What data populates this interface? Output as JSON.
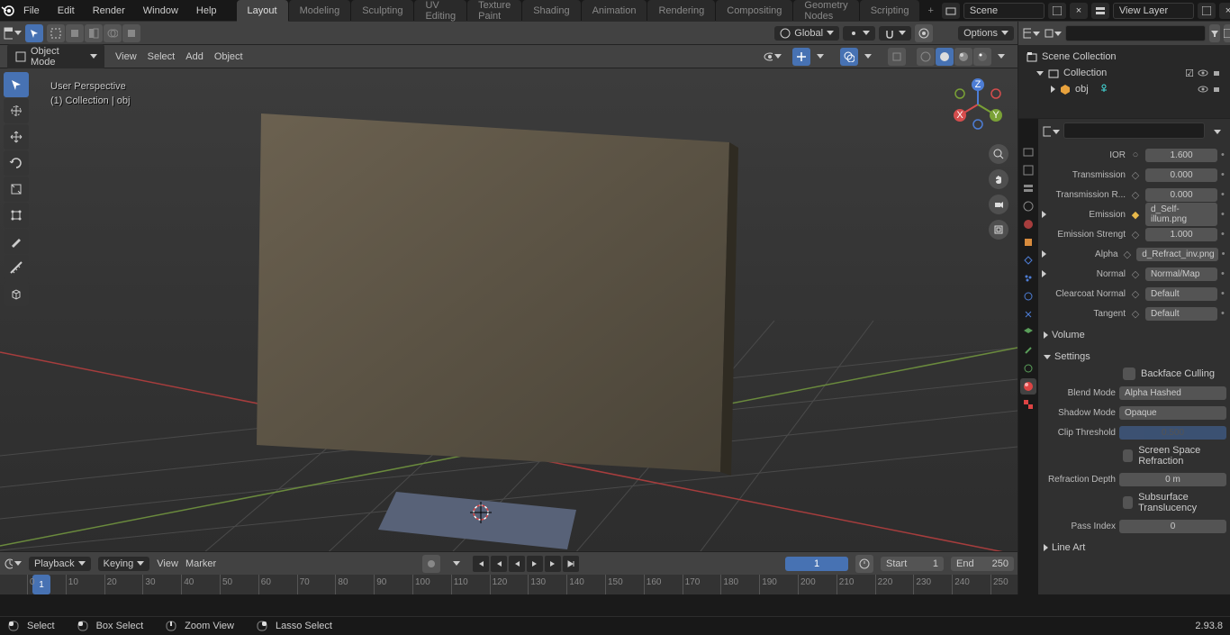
{
  "top_menu": [
    "File",
    "Edit",
    "Render",
    "Window",
    "Help"
  ],
  "workspaces": [
    "Layout",
    "Modeling",
    "Sculpting",
    "UV Editing",
    "Texture Paint",
    "Shading",
    "Animation",
    "Rendering",
    "Compositing",
    "Geometry Nodes",
    "Scripting"
  ],
  "active_workspace": 0,
  "scene_name": "Scene",
  "view_layer": "View Layer",
  "viewport": {
    "mode": "Object Mode",
    "orientation": "Global",
    "menus": [
      "View",
      "Select",
      "Add",
      "Object"
    ],
    "options_label": "Options",
    "overlay_line1": "User Perspective",
    "overlay_line2": "(1) Collection | obj"
  },
  "outliner": {
    "root": "Scene Collection",
    "collection": "Collection",
    "object": "obj"
  },
  "properties": {
    "rows": [
      {
        "label": "IOR",
        "dot": "",
        "val": "1.600",
        "type": "num",
        "expand": false
      },
      {
        "label": "Transmission",
        "dot": "gray",
        "val": "0.000",
        "type": "num",
        "expand": false
      },
      {
        "label": "Transmission R...",
        "dot": "gray",
        "val": "0.000",
        "type": "num",
        "expand": false
      },
      {
        "label": "Emission",
        "dot": "yellow",
        "val": "d_Self-illum.png",
        "type": "text",
        "expand": true
      },
      {
        "label": "Emission Strengt",
        "dot": "gray",
        "val": "1.000",
        "type": "num",
        "expand": false
      },
      {
        "label": "Alpha",
        "dot": "gray",
        "val": "d_Refract_inv.png",
        "type": "text",
        "expand": true
      },
      {
        "label": "Normal",
        "dot": "gray",
        "val": "Normal/Map",
        "type": "text",
        "expand": true
      },
      {
        "label": "Clearcoat Normal",
        "dot": "gray",
        "val": "Default",
        "type": "text",
        "expand": false
      },
      {
        "label": "Tangent",
        "dot": "gray",
        "val": "Default",
        "type": "text",
        "expand": false
      }
    ],
    "sections": [
      "Volume",
      "Settings",
      "Line Art"
    ],
    "settings": {
      "backface": "Backface Culling",
      "blend_mode_label": "Blend Mode",
      "blend_mode": "Alpha Hashed",
      "shadow_mode_label": "Shadow Mode",
      "shadow_mode": "Opaque",
      "clip_label": "Clip Threshold",
      "clip": "0.500",
      "ssr": "Screen Space Refraction",
      "refr_depth_label": "Refraction Depth",
      "refr_depth": "0 m",
      "sst": "Subsurface Translucency",
      "pass_label": "Pass Index",
      "pass": "0"
    }
  },
  "timeline": {
    "menus": [
      "Playback",
      "Keying",
      "View",
      "Marker"
    ],
    "frame": "1",
    "start_label": "Start",
    "start": "1",
    "end_label": "End",
    "end": "250",
    "ticks": [
      "0",
      "10",
      "20",
      "30",
      "40",
      "50",
      "60",
      "70",
      "80",
      "90",
      "100",
      "110",
      "120",
      "130",
      "140",
      "150",
      "160",
      "170",
      "180",
      "190",
      "200",
      "210",
      "220",
      "230",
      "240",
      "250"
    ],
    "playhead": "1"
  },
  "status": {
    "select": "Select",
    "box": "Box Select",
    "zoom": "Zoom View",
    "lasso": "Lasso Select",
    "version": "2.93.8"
  }
}
